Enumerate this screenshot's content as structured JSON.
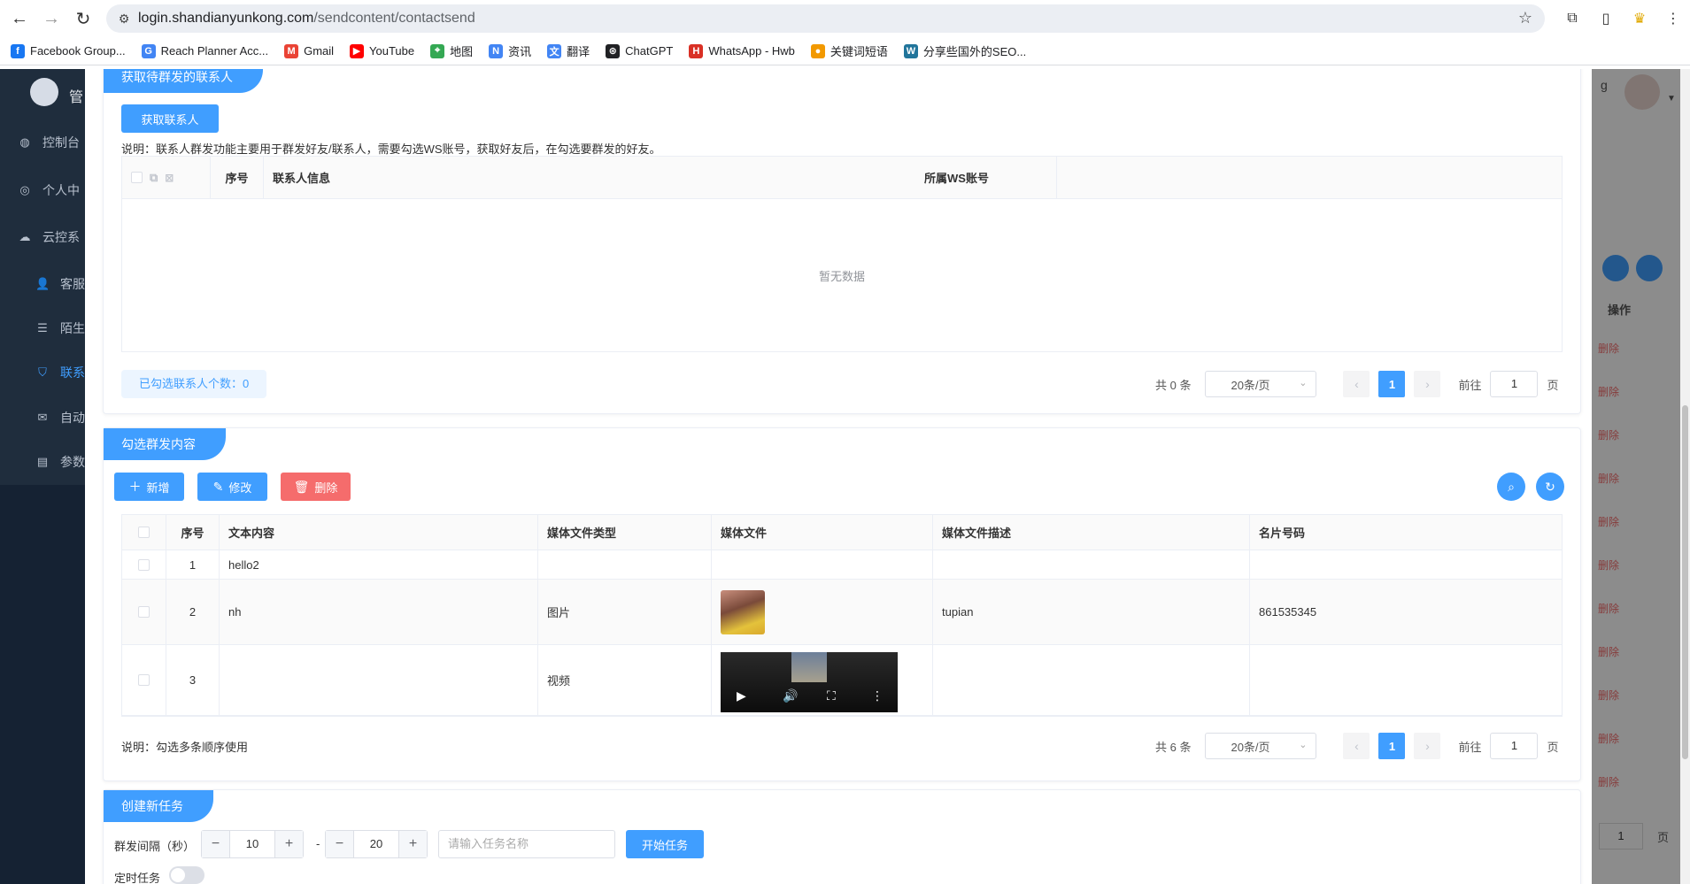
{
  "browser": {
    "url_host": "login.shandianyunkong.com",
    "url_path": "/sendcontent/contactsend",
    "bookmarks": [
      {
        "label": "Facebook Group...",
        "icon": "facebook-icon",
        "color": "#1877f2",
        "glyph": "f"
      },
      {
        "label": "Reach Planner Acc...",
        "icon": "google-icon",
        "color": "#4285f4",
        "glyph": "G"
      },
      {
        "label": "Gmail",
        "icon": "gmail-icon",
        "color": "#ea4335",
        "glyph": "M"
      },
      {
        "label": "YouTube",
        "icon": "youtube-icon",
        "color": "#ff0000",
        "glyph": "▶"
      },
      {
        "label": "地图",
        "icon": "maps-icon",
        "color": "#34a853",
        "glyph": "⌖"
      },
      {
        "label": "资讯",
        "icon": "news-icon",
        "color": "#4285f4",
        "glyph": "N"
      },
      {
        "label": "翻译",
        "icon": "translate-icon",
        "color": "#4285f4",
        "glyph": "文"
      },
      {
        "label": "ChatGPT",
        "icon": "chatgpt-icon",
        "color": "#202124",
        "glyph": "⊛"
      },
      {
        "label": "WhatsApp - Hwb",
        "icon": "hwb-icon",
        "color": "#d93025",
        "glyph": "H"
      },
      {
        "label": "关键词短语",
        "icon": "keyword-icon",
        "color": "#f29900",
        "glyph": "●"
      },
      {
        "label": "分享些国外的SEO...",
        "icon": "wordpress-icon",
        "color": "#21759b",
        "glyph": "W"
      }
    ]
  },
  "sidebar": {
    "logo_text": "管",
    "items": [
      {
        "label": "控制台",
        "icon": "dashboard-icon"
      },
      {
        "label": "个人中",
        "icon": "user-circle-icon"
      },
      {
        "label": "云控系",
        "icon": "cloud-icon"
      },
      {
        "label": "客服",
        "icon": "person-icon"
      },
      {
        "label": "陌生",
        "icon": "list-icon"
      },
      {
        "label": "联系",
        "icon": "shield-icon"
      },
      {
        "label": "自动",
        "icon": "chat-icon"
      },
      {
        "label": "参数",
        "icon": "grid-icon"
      }
    ]
  },
  "background": {
    "header_letter": "g",
    "op_header": "操作",
    "delete_label": "删除",
    "page_value": "1",
    "page_label": "页"
  },
  "panel_contacts": {
    "title": "获取待群发的联系人",
    "fetch_button": "获取联系人",
    "note": "说明：联系人群发功能主要用于群发好友/联系人，需要勾选WS账号，获取好友后，在勾选要群发的好友。",
    "columns": [
      "序号",
      "联系人信息",
      "所属WS账号"
    ],
    "empty_text": "暂无数据",
    "selected_count": "已勾选联系人个数：0",
    "pagination": {
      "total": "共 0 条",
      "page_size": "20条/页",
      "current": "1",
      "goto": "前往",
      "goto_value": "1",
      "page_suffix": "页"
    }
  },
  "panel_content": {
    "title": "勾选群发内容",
    "add_button": "新增",
    "edit_button": "修改",
    "delete_button": "删除",
    "columns": [
      "序号",
      "文本内容",
      "媒体文件类型",
      "媒体文件",
      "媒体文件描述",
      "名片号码"
    ],
    "rows": [
      {
        "index": "1",
        "text": "hello2",
        "media_type": "",
        "media": "",
        "desc": "",
        "card": ""
      },
      {
        "index": "2",
        "text": "nh",
        "media_type": "图片",
        "media": "image",
        "desc": "tupian",
        "card": "861535345"
      },
      {
        "index": "3",
        "text": "",
        "media_type": "视频",
        "media": "video",
        "desc": "",
        "card": ""
      }
    ],
    "note": "说明：勾选多条顺序使用",
    "pagination": {
      "total": "共 6 条",
      "page_size": "20条/页",
      "current": "1",
      "goto": "前往",
      "goto_value": "1",
      "page_suffix": "页"
    }
  },
  "panel_task": {
    "title": "创建新任务",
    "interval_label": "群发间隔（秒）",
    "min_value": "10",
    "dash": "-",
    "max_value": "20",
    "task_name_placeholder": "请输入任务名称",
    "start_button": "开始任务",
    "timer_label": "定时任务"
  },
  "colors": {
    "primary": "#409eff",
    "danger": "#f56c6c",
    "sidebar": "#1f2d3d"
  }
}
